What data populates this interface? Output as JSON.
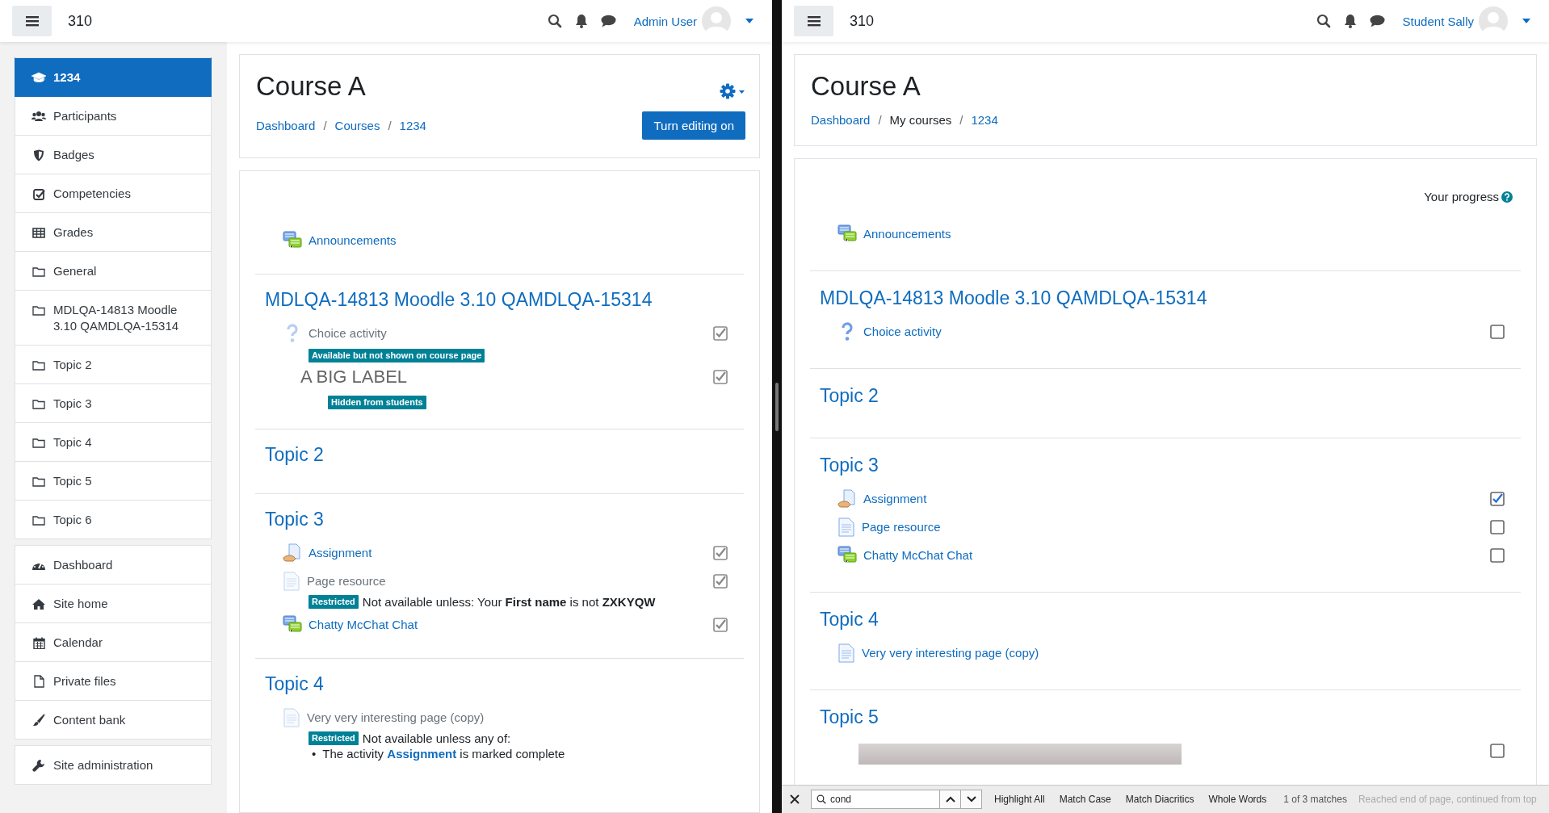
{
  "panes": [
    {
      "header": {
        "site_name": "310",
        "user": "Admin User"
      },
      "sidebar": {
        "groups": [
          [
            {
              "label": "1234",
              "selected": true
            },
            {
              "label": "Participants",
              "selected": false
            },
            {
              "label": "Badges",
              "selected": false
            },
            {
              "label": "Competencies",
              "selected": false
            },
            {
              "label": "Grades",
              "selected": false
            },
            {
              "label": "General",
              "selected": false
            },
            {
              "label": "MDLQA-14813 Moodle 3.10 QAMDLQA-15314",
              "selected": false
            },
            {
              "label": "Topic 2",
              "selected": false
            },
            {
              "label": "Topic 3",
              "selected": false
            },
            {
              "label": "Topic 4",
              "selected": false
            },
            {
              "label": "Topic 5",
              "selected": false
            },
            {
              "label": "Topic 6",
              "selected": false
            }
          ],
          [
            {
              "label": "Dashboard",
              "selected": false
            },
            {
              "label": "Site home",
              "selected": false
            },
            {
              "label": "Calendar",
              "selected": false
            },
            {
              "label": "Private files",
              "selected": false
            },
            {
              "label": "Content bank",
              "selected": false
            }
          ],
          [
            {
              "label": "Site administration",
              "selected": false
            }
          ]
        ]
      },
      "course": {
        "title": "Course A",
        "breadcrumb_separator": "/",
        "breadcrumb": [
          {
            "label": "Dashboard",
            "link": true
          },
          {
            "label": "Courses",
            "link": true
          },
          {
            "label": "1234",
            "link": true
          }
        ],
        "settings_menu": true,
        "edit_button": "Turn editing on"
      },
      "sections": [
        {
          "activities": [
            {
              "kind": "forum",
              "name": "Announcements"
            }
          ]
        },
        {
          "title": "MDLQA-14813 Moodle 3.10 QAMDLQA-15314",
          "activities": [
            {
              "kind": "choice",
              "name": "Choice activity",
              "dimmed": true,
              "completion": {
                "checked": true,
                "disabled": true
              },
              "badges": [
                "Available but not shown on course page"
              ]
            },
            {
              "kind": "label",
              "name": "A BIG LABEL",
              "dimmed": true,
              "completion": {
                "checked": true,
                "disabled": true
              },
              "badges": [
                "Hidden from students"
              ]
            }
          ]
        },
        {
          "title": "Topic 2"
        },
        {
          "title": "Topic 3",
          "activities": [
            {
              "kind": "assign",
              "name": "Assignment",
              "completion": {
                "checked": true,
                "disabled": true
              }
            },
            {
              "kind": "page",
              "name": "Page resource",
              "dimmed": true,
              "completion": {
                "checked": true,
                "disabled": true
              },
              "restriction": {
                "badge": "Restricted",
                "text": "Not available unless: Your **First name** is not **ZXKYQW**"
              }
            },
            {
              "kind": "chat",
              "name": "Chatty McChat Chat",
              "completion": {
                "checked": true,
                "disabled": true
              }
            }
          ]
        },
        {
          "title": "Topic 4",
          "activities": [
            {
              "kind": "page",
              "name": "Very very interesting page (copy)",
              "dimmed": true,
              "restriction": {
                "badge": "Restricted",
                "text": "Not available unless any of:",
                "items": [
                  {
                    "bullet": "•",
                    "parts": [
                      {
                        "text": "The activity "
                      },
                      {
                        "text": "Assignment",
                        "link": true
                      },
                      {
                        "text": " is marked complete"
                      }
                    ]
                  }
                ]
              }
            }
          ]
        }
      ]
    },
    {
      "header": {
        "site_name": "310",
        "user": "Student Sally"
      },
      "course": {
        "title": "Course A",
        "breadcrumb_separator": "/",
        "breadcrumb": [
          {
            "label": "Dashboard",
            "link": true
          },
          {
            "label": "My courses",
            "link": false
          },
          {
            "label": "1234",
            "link": true
          }
        ]
      },
      "progress_label": "Your progress",
      "sections": [
        {
          "activities": [
            {
              "kind": "forum",
              "name": "Announcements"
            }
          ]
        },
        {
          "title": "MDLQA-14813 Moodle 3.10 QAMDLQA-15314",
          "activities": [
            {
              "kind": "choice",
              "name": "Choice activity",
              "completion": {
                "checked": false,
                "disabled": false
              }
            }
          ]
        },
        {
          "title": "Topic 2"
        },
        {
          "title": "Topic 3",
          "activities": [
            {
              "kind": "assign",
              "name": "Assignment",
              "completion": {
                "checked": true,
                "disabled": false
              }
            },
            {
              "kind": "page",
              "name": "Page resource",
              "completion": {
                "checked": false,
                "disabled": false
              }
            },
            {
              "kind": "chat",
              "name": "Chatty McChat Chat",
              "completion": {
                "checked": false,
                "disabled": false
              }
            }
          ]
        },
        {
          "title": "Topic 4",
          "activities": [
            {
              "kind": "page",
              "name": "Very very interesting page (copy)"
            }
          ]
        },
        {
          "title": "Topic 5",
          "activities": [
            {
              "kind": "image",
              "completion": {
                "checked": false,
                "disabled": false
              }
            }
          ]
        }
      ],
      "find_bar": {
        "query": "cond",
        "options": [
          "Highlight All",
          "Match Case",
          "Match Diacritics",
          "Whole Words"
        ],
        "count": "1 of 3 matches",
        "status": "Reached end of page, continued from top"
      }
    }
  ]
}
